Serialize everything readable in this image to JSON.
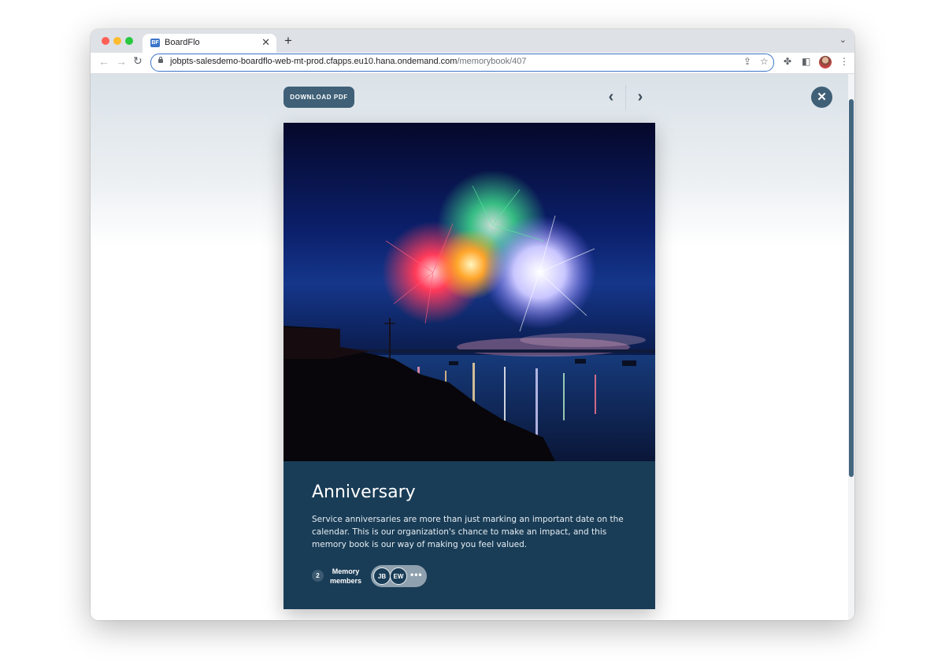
{
  "browser": {
    "tab_title": "BoardFlo",
    "tab_favicon_text": "BF",
    "url_host": "jobpts-salesdemo-boardflo-web-mt-prod.cfapps.eu10.hana.ondemand.com",
    "url_path": "/memorybook/407"
  },
  "toolbar": {
    "download_label": "DOWNLOAD PDF"
  },
  "card": {
    "title": "Anniversary",
    "description": "Service anniversaries are more than just marking an important date on the calendar. This is our organization's chance to make an impact, and this memory book is our way of making you feel valued.",
    "member_count": "2",
    "member_label_line1": "Memory",
    "member_label_line2": "members",
    "avatars": [
      "JB",
      "EW"
    ],
    "more": "•••"
  },
  "colors": {
    "card_background": "#1a3d57",
    "button_background": "#3f6077",
    "accent_scrollbar": "#45667f"
  },
  "icons": [
    "chevron-left-icon",
    "chevron-right-icon",
    "close-icon",
    "lock-icon",
    "share-icon",
    "star-icon",
    "extensions-icon",
    "sidepanel-icon",
    "kebab-menu-icon"
  ]
}
